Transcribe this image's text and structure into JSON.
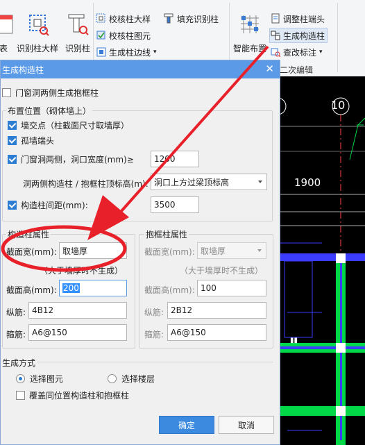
{
  "ribbon": {
    "big_buttons": [
      {
        "label": "表"
      },
      {
        "label": "识别柱大样"
      },
      {
        "label": "识别柱"
      },
      {
        "label": "智能布置"
      }
    ],
    "small_buttons": {
      "check_column_detail": "校核柱大样",
      "check_column_figure": "校核柱图元",
      "gen_column_edge": "生成柱边线",
      "fill_identify_column": "填充识别柱",
      "adjust_column_end": "调整柱端头",
      "gen_constructional_column": "生成构造柱",
      "modify_annotation": "查改标注"
    },
    "group_label": "二次编辑"
  },
  "cad": {
    "axis_number": "10",
    "dimension": "1900",
    "accent_green": "#00d84a",
    "accent_blue": "#3c3cff"
  },
  "dialog": {
    "title": "生成构造柱",
    "gen_hug_column_label": "门窗洞两侧生成抱框柱",
    "placement": {
      "legend": "布置位置（砌体墙上）",
      "wall_intersection": "墙交点（柱截面尺寸取墙厚）",
      "isolated_wall_end": "孤墙端头",
      "door_window_both_sides": "门窗洞两侧，洞口宽度(mm)≥",
      "door_window_width_value": "1200",
      "top_elev_label": "洞两侧构造柱 / 抱框柱顶标高(m):",
      "top_elev_value": "洞口上方过梁顶标高",
      "spacing_label": "构造柱间距(mm):",
      "spacing_value": "3500"
    },
    "constructional": {
      "legend": "构造柱属性",
      "section_width_label": "截面宽(mm):",
      "section_width_value": "取墙厚",
      "note": "（大于墙厚时不生成）",
      "section_height_label": "截面高(mm):",
      "section_height_value": "200",
      "longitudinal_label": "纵筋:",
      "longitudinal_value": "4B12",
      "stirrup_label": "箍筋:",
      "stirrup_value": "A6@150"
    },
    "hug": {
      "legend": "抱框柱属性",
      "section_width_label": "截面宽(mm):",
      "section_width_value": "取墙厚",
      "note": "（大于墙厚时不生成）",
      "section_height_label": "截面高(mm):",
      "section_height_value": "100",
      "longitudinal_label": "纵筋:",
      "longitudinal_value": "2B12",
      "stirrup_label": "箍筋:",
      "stirrup_value": "A6@150"
    },
    "generate_mode": {
      "legend": "生成方式",
      "option_select_figure": "选择图元",
      "option_select_floor": "选择楼层",
      "override_label": "覆盖同位置构造柱和抱框柱"
    },
    "ok_label": "确定",
    "cancel_label": "取消"
  },
  "annotation": {
    "color": "#e8202a"
  }
}
